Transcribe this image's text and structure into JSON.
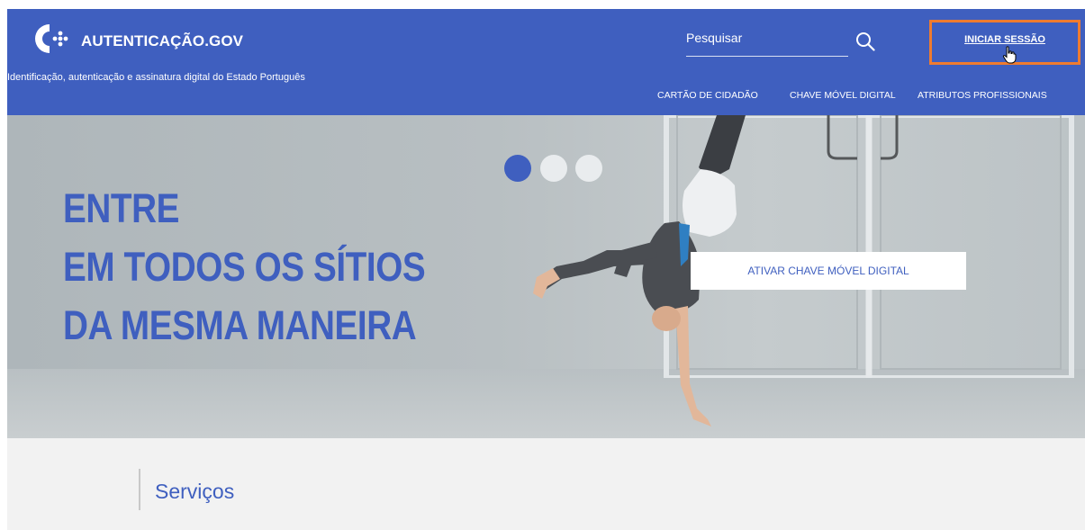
{
  "header": {
    "logo_text": "AUTENTICAÇÃO.GOV",
    "tagline": "Identificação, autenticação e assinatura digital do Estado Português",
    "search_placeholder": "Pesquisar",
    "login_label": "INICIAR SESSÃO",
    "nav": [
      {
        "label": "CARTÃO DE CIDADÃO"
      },
      {
        "label": "CHAVE MÓVEL DIGITAL"
      },
      {
        "label": "ATRIBUTOS PROFISSIONAIS"
      }
    ]
  },
  "hero": {
    "headline": [
      "ENTRE",
      "EM TODOS OS SÍTIOS",
      "DA MESMA MANEIRA"
    ],
    "cta_label": "ATIVAR CHAVE MÓVEL DIGITAL",
    "carousel": {
      "slides": 3,
      "active": 1
    }
  },
  "services": {
    "title": "Serviços"
  },
  "colors": {
    "brand": "#3f5fbf",
    "highlight": "#ef7b2f",
    "services_bg": "#f2f2f2"
  },
  "icons": [
    "logo-icon",
    "search-icon",
    "hand-cursor-icon"
  ]
}
